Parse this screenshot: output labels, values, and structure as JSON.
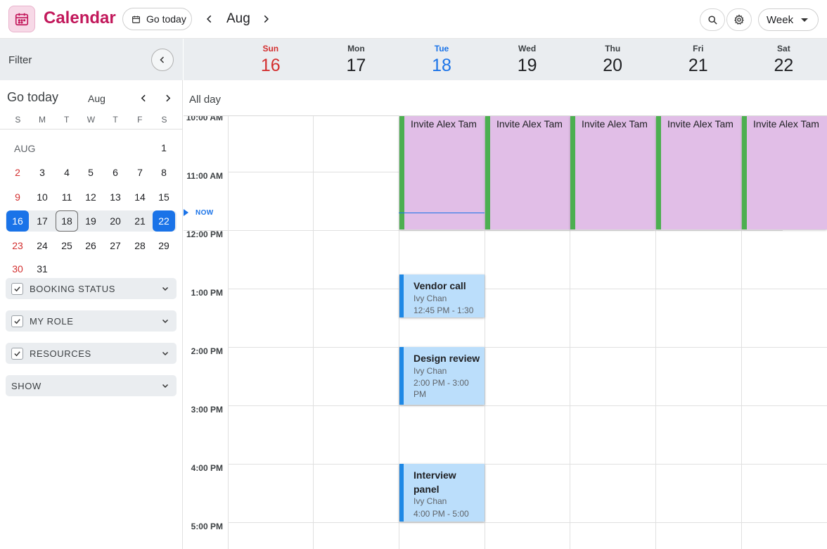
{
  "header": {
    "app_title": "Calendar",
    "go_today": "Go today",
    "month": "Aug",
    "view": "Week",
    "icons": [
      "calendar-icon",
      "chevron-left-icon",
      "chevron-right-icon",
      "search-icon",
      "gear-icon"
    ]
  },
  "sidebar": {
    "filter_label": "Filter",
    "mini": {
      "go_today": "Go today",
      "month": "Aug",
      "weekday_initials": [
        "S",
        "M",
        "T",
        "W",
        "T",
        "F",
        "S"
      ],
      "month_label": "AUG",
      "days": {
        "d1": "1",
        "d2": "2",
        "d3": "3",
        "d4": "4",
        "d5": "5",
        "d6": "6",
        "d7": "7",
        "d8": "8",
        "d9": "9",
        "d10": "10",
        "d11": "11",
        "d12": "12",
        "d13": "13",
        "d14": "14",
        "d15": "15",
        "d16": "16",
        "d17": "17",
        "d18": "18",
        "d19": "19",
        "d20": "20",
        "d21": "21",
        "d22": "22",
        "d23": "23",
        "d24": "24",
        "d25": "25",
        "d26": "26",
        "d27": "27",
        "d28": "28",
        "d29": "29",
        "d30": "30",
        "d31": "31"
      },
      "selected_days": [
        "16",
        "22"
      ],
      "today": "18"
    },
    "filters": [
      {
        "label": "BOOKING STATUS",
        "checked": true
      },
      {
        "label": "MY ROLE",
        "checked": true
      },
      {
        "label": "RESOURCES",
        "checked": true
      },
      {
        "label": "SHOW",
        "checked": false
      }
    ]
  },
  "week": {
    "days": [
      {
        "name": "Sun",
        "date": "16"
      },
      {
        "name": "Mon",
        "date": "17"
      },
      {
        "name": "Tue",
        "date": "18"
      },
      {
        "name": "Wed",
        "date": "19"
      },
      {
        "name": "Thu",
        "date": "20"
      },
      {
        "name": "Fri",
        "date": "21"
      },
      {
        "name": "Sat",
        "date": "22"
      }
    ],
    "current_day": "Tue",
    "all_day_label": "All day",
    "now_label": "NOW",
    "times": [
      "10:00 AM",
      "11:00 AM",
      "12:00 PM",
      "1:00 PM",
      "2:00 PM",
      "3:00 PM",
      "4:00 PM",
      "5:00 PM"
    ]
  },
  "events": {
    "invite": {
      "title": "Invite Alex Tam",
      "days": [
        "Tue",
        "Wed",
        "Thu",
        "Fri",
        "Sat"
      ],
      "color": "#e1bee7",
      "accent": "#4caf50"
    },
    "vendor": {
      "title": "Vendor call",
      "organizer": "Ivy Chan",
      "time": "12:45 PM - 1:30",
      "day": "Tue",
      "color": "#bbdefb",
      "accent": "#1e88e5"
    },
    "design": {
      "title": "Design review",
      "organizer": "Ivy Chan",
      "time": "2:00 PM - 3:00 PM",
      "day": "Tue",
      "color": "#bbdefb",
      "accent": "#1e88e5"
    },
    "interview": {
      "title": "Interview panel",
      "organizer": "Ivy Chan",
      "time": "4:00 PM - 5:00",
      "day": "Tue",
      "color": "#bbdefb",
      "accent": "#1e88e5"
    }
  },
  "colors": {
    "brand": "#c2185b",
    "accent_blue": "#1a73e8",
    "sunday_red": "#d32f2f",
    "header_bg": "#eaedf0"
  }
}
